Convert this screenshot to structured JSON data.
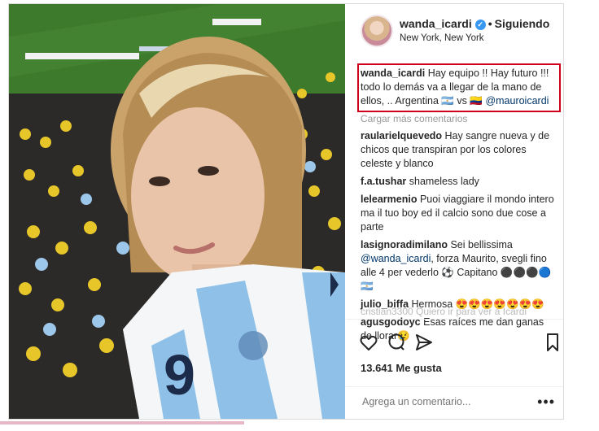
{
  "header": {
    "username": "wanda_icardi",
    "follow_label": "Siguiendo",
    "location": "New York, New York"
  },
  "caption": {
    "username": "wanda_icardi",
    "text_before": "Hay equipo !! Hay futuro !!! todo lo demás va a llegar de la mano de ellos, .. Argentina 🇦🇷 vs 🇨🇴",
    "mention": "@mauroicardi"
  },
  "load_more": "Cargar más comentarios",
  "comments": [
    {
      "user": "raularielquevedo",
      "text": "Hay sangre nueva y de chicos que transpiran por los colores celeste y blanco"
    },
    {
      "user": "f.a.tushar",
      "text": "shameless lady"
    },
    {
      "user": "lelearmenio",
      "text": "Puoi viaggiare il mondo intero ma il tuo boy ed il calcio sono due cose a parte"
    },
    {
      "user": "lasignoradimilano",
      "text": "Sei bellissima",
      "mention": "@wanda_icardi",
      "text_after": ", forza Maurito, svegli fino alle 4 per vederlo ⚽ Capitano ⚫⚫⚫🔵🇦🇷"
    },
    {
      "user": "julio_biffa",
      "text": "Hermosa 😍😍😍😍😍😍😍"
    },
    {
      "user": "agusgodoyc",
      "text": "Esas raíces me dan ganas de llorar😢"
    }
  ],
  "partial_comment": "cristian3300 Quiero ir para ver a Icardi",
  "likes": "13.641 Me gusta",
  "add_comment_placeholder": "Agrega un comentario...",
  "icons": [
    "heart-icon",
    "comment-icon",
    "share-icon",
    "bookmark-icon",
    "more-icon",
    "verified-icon"
  ],
  "colors": {
    "highlight_border": "#d0021b",
    "verified": "#3897f0",
    "link": "#003569"
  }
}
